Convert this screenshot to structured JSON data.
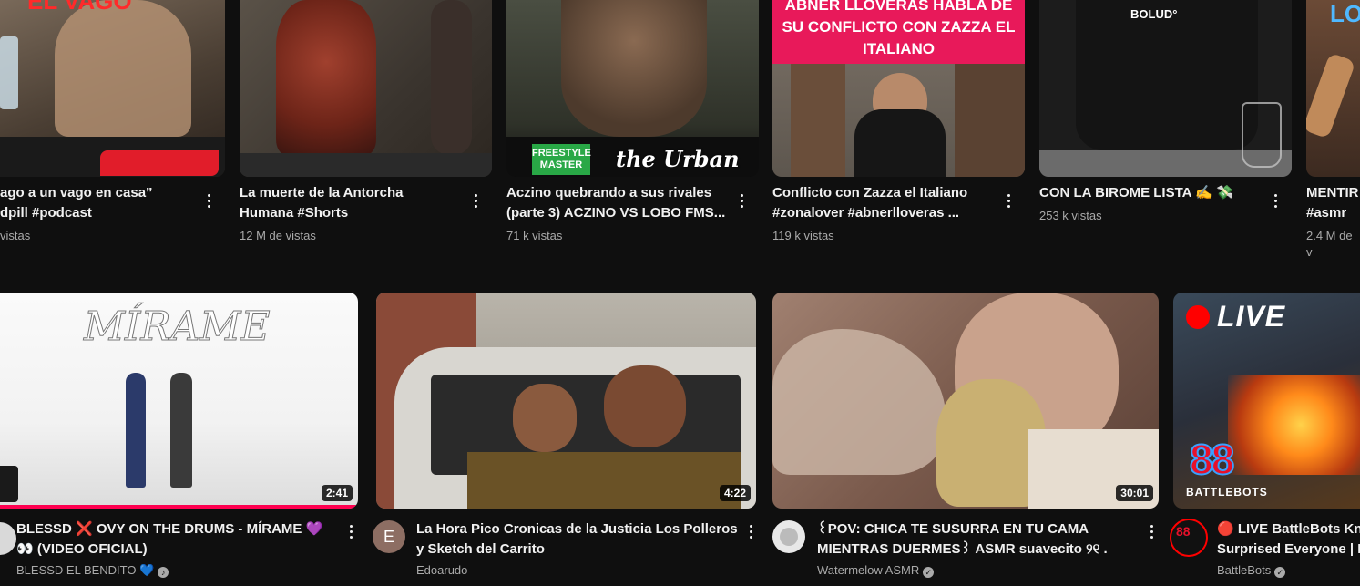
{
  "top_row": [
    {
      "overlay": "EL VAGO",
      "title_lines": [
        "ago a un vago en casa”",
        "dpill #podcast"
      ],
      "meta": "vistas"
    },
    {
      "title_lines": [
        "La muerte de la Antorcha",
        "Humana #Shorts"
      ],
      "meta": "12 M de vistas"
    },
    {
      "overlay_a": "FREESTYLE MASTER",
      "overlay_b": "the Urban",
      "title_lines": [
        "Aczino quebrando a sus rivales",
        "(parte 3) ACZINO VS LOBO FMS..."
      ],
      "meta": "71 k vistas"
    },
    {
      "overlay": "ABNER LLOVERAS HABLA DE SU CONFLICTO CON ZAZZA EL ITALIANO",
      "title_lines": [
        "Conflicto con Zazza el Italiano",
        "#zonalover #abnerlloveras ..."
      ],
      "meta": "119 k vistas"
    },
    {
      "overlay": "BOLUD°",
      "title_lines": [
        "CON LA BIROME LISTA ✍️ 💸"
      ],
      "meta": "253 k vistas"
    },
    {
      "overlay": "LO",
      "title_lines": [
        "MENTIR",
        "#asmr"
      ],
      "meta": "2.4 M de v"
    }
  ],
  "bottom_row": [
    {
      "overlay": "MÍRAME",
      "duration": "2:41",
      "title_lines": [
        "BLESSD ❌ OVY ON THE DRUMS - MÍRAME 💜",
        "👀 (VIDEO OFICIAL)"
      ],
      "channel": "BLESSD EL BENDITO 💙",
      "avatar_letter": ""
    },
    {
      "duration": "4:22",
      "title_lines": [
        "La Hora Pico Cronicas de la Justicia Los Polleros",
        "y Sketch del Carrito"
      ],
      "channel": "Edoarudo",
      "avatar_letter": "E"
    },
    {
      "duration": "30:01",
      "title_lines": [
        "꒰POV: CHICA TE SUSURRA EN TU CAMA",
        "MIENTRAS DUERMES꒱ ASMR suavecito ୨୧ ."
      ],
      "channel": "Watermelow ASMR",
      "avatar_letter": ""
    },
    {
      "overlay_live": "LIVE",
      "overlay_logo": "BATTLEBOTS",
      "overlay_logo_mark": "88",
      "title_lines": [
        "🔴 LIVE BattleBots Kn",
        "Surprised Everyone | B"
      ],
      "channel": "BattleBots",
      "avatar_letter": ""
    }
  ],
  "colors": {
    "background": "#0f0f0f",
    "text": "#f1f1f1",
    "meta": "#aaaaaa",
    "progress": "#ff0050",
    "live_red": "#ff0000"
  },
  "icons": {
    "more": "three-dot-vertical-icon",
    "verified": "check-circle-icon"
  }
}
